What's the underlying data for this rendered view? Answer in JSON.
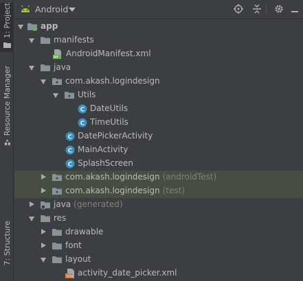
{
  "sidebar": {
    "project_tab": "1: Project",
    "resource_manager_tab": "Resource Manager",
    "structure_tab": "7: Structure"
  },
  "header": {
    "title": "Android",
    "target_icon": "locate-target-icon",
    "collapse_icon": "collapse-all-icon",
    "settings_icon": "gear-icon",
    "hide_icon": "minimize-icon"
  },
  "tree": {
    "app": "app",
    "manifests": "manifests",
    "manifest_file": "AndroidManifest.xml",
    "java": "java",
    "pkg_main": "com.akash.logindesign",
    "utils": "Utils",
    "date_utils": "DateUtils",
    "time_utils": "TimeUtils",
    "date_picker_activity": "DatePickerActivity",
    "main_activity": "MainActivity",
    "splash_screen": "SplashScreen",
    "pkg_android_test": "com.akash.logindesign",
    "pkg_android_test_suffix": "(androidTest)",
    "pkg_test": "com.akash.logindesign",
    "pkg_test_suffix": "(test)",
    "java_generated": "java",
    "java_generated_suffix": "(generated)",
    "res": "res",
    "drawable": "drawable",
    "font": "font",
    "layout": "layout",
    "layout_file": "activity_date_picker.xml"
  },
  "colors": {
    "background": "#3c3f41",
    "highlight": "#464d41",
    "folder": "#87939a",
    "java_class": "#3592c4",
    "text": "#bbbbbb",
    "suffix": "#808080"
  }
}
